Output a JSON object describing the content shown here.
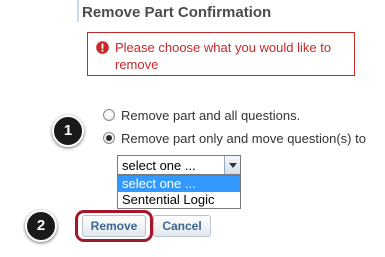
{
  "page_title": "Remove Part Confirmation",
  "error": {
    "icon": "exclamation-circle-icon",
    "message": "Please choose what you would like to remove",
    "color": "#c82829"
  },
  "steps": {
    "step1": "1",
    "step2": "2"
  },
  "options": {
    "remove_all": {
      "label": "Remove part and all questions.",
      "checked": false
    },
    "move_questions": {
      "label": "Remove part only and move question(s) to",
      "checked": true
    }
  },
  "move_target_select": {
    "selected": "select one ...",
    "options": [
      "select one ...",
      "Sentential Logic"
    ],
    "highlighted_index": 0
  },
  "buttons": {
    "remove": "Remove",
    "cancel": "Cancel"
  },
  "colors": {
    "highlight": "#a3172b",
    "button_text": "#3d6591",
    "selected_option": "#3399ff"
  }
}
